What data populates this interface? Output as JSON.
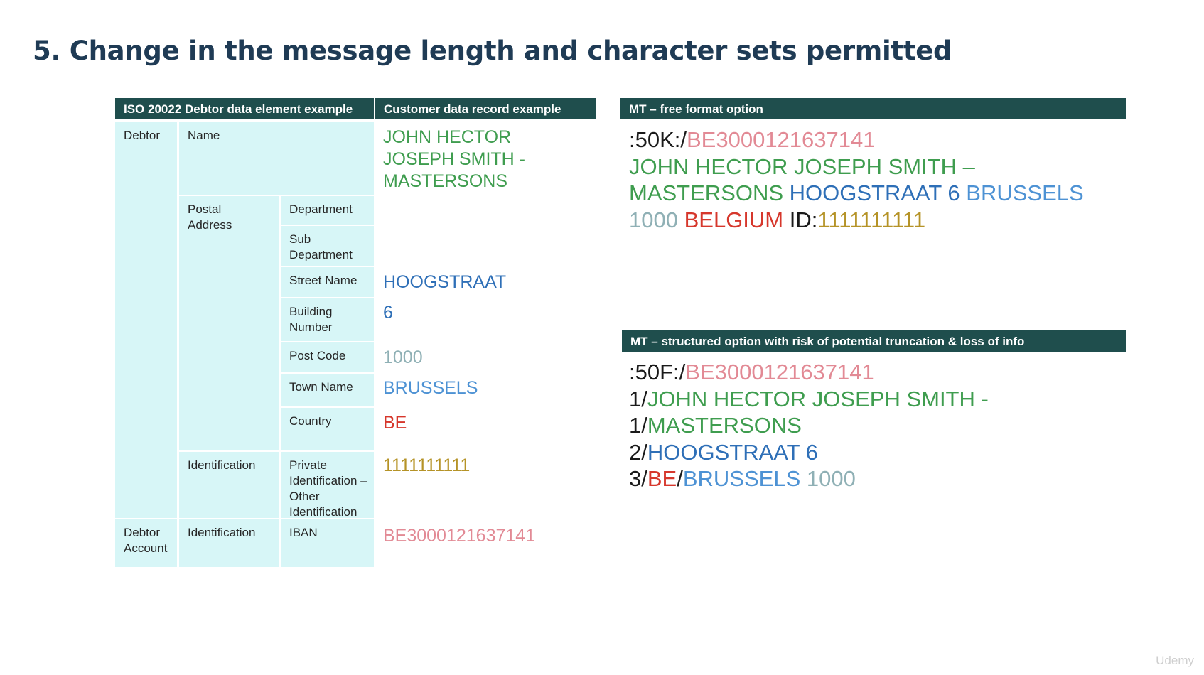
{
  "title": "5. Change in the message length and character sets permitted",
  "left_table": {
    "header_element": "ISO 20022 Debtor data element example",
    "header_record": "Customer data record example",
    "labels": {
      "debtor": "Debtor",
      "name": "Name",
      "postal_address": "Postal Address",
      "department": "Department",
      "sub_department": "Sub Department",
      "street_name": "Street Name",
      "building_number": "Building Number",
      "post_code": "Post Code",
      "town_name": "Town Name",
      "country": "Country",
      "identification": "Identification",
      "private_identification": "Private Identification – Other Identification",
      "debtor_account": "Debtor Account",
      "account_identification": "Identification",
      "iban": "IBAN"
    },
    "values": {
      "name_line1": "JOHN HECTOR",
      "name_line2": "JOSEPH SMITH -",
      "name_line3": "MASTERSONS",
      "street_name": "HOOGSTRAAT",
      "building_number": "6",
      "post_code": "1000",
      "town_name": "BRUSSELS",
      "country": "BE",
      "private_identification": "1111111111",
      "iban": "BE3000121637141"
    }
  },
  "free_format": {
    "header": "MT – free format option",
    "tag": ":50K:/",
    "account": "BE3000121637141",
    "name_a": "JOHN HECTOR JOSEPH SMITH –",
    "name_b": "MASTERSONS",
    "street": "HOOGSTRAAT 6",
    "town": "BRUSSELS",
    "post_code": "1000",
    "country": "BELGIUM",
    "id_label": "ID:",
    "id_value": "1111111111"
  },
  "structured": {
    "header": "MT – structured option with risk of potential truncation & loss of info",
    "tag": ":50F:/",
    "account": "BE3000121637141",
    "line1_prefix": "1/",
    "line1_text": "JOHN HECTOR JOSEPH SMITH -",
    "line2_prefix": "1/",
    "line2_text": "MASTERSONS",
    "line3_prefix": "2/",
    "line3_text": "HOOGSTRAAT 6",
    "line4_prefix": "3/",
    "line4_country": "BE",
    "line4_sep": "/",
    "line4_town": "BRUSSELS",
    "line4_post": "1000"
  },
  "colors": {
    "header_bg": "#1f4e4d",
    "cell_bg": "#d7f6f7",
    "title": "#1f3b55",
    "name": "#3f9d4f",
    "street": "#2e6fb7",
    "town": "#4d92d4",
    "post_code": "#8fb0b5",
    "country": "#d6372c",
    "identification": "#b59327",
    "account": "#e28a95"
  },
  "watermark": "Udemy"
}
